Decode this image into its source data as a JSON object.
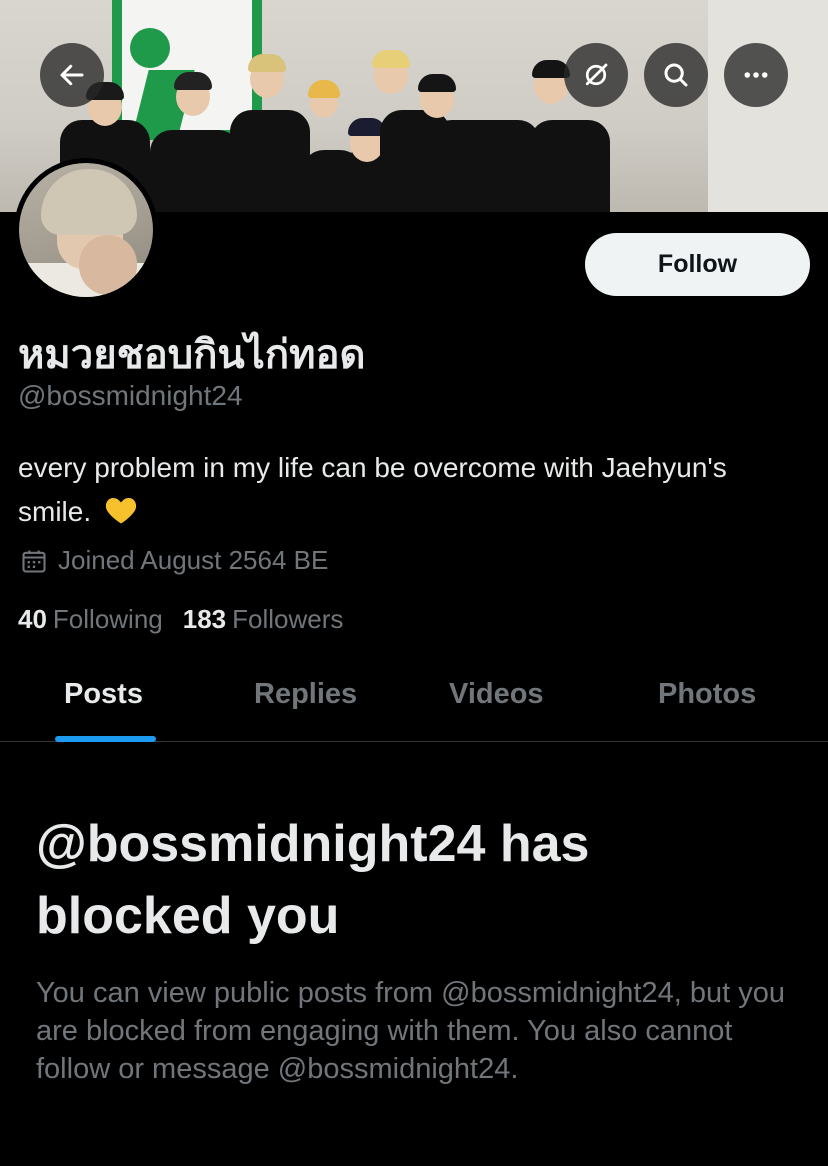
{
  "header": {
    "back_icon": "arrow-left-icon",
    "icons": [
      "grok-icon",
      "search-icon",
      "more-icon"
    ]
  },
  "profile": {
    "display_name": "หมวยชอบกินไก่ทอด",
    "handle": "@bossmidnight24",
    "bio": "every problem in my life can be overcome with Jaehyun's smile.",
    "bio_emoji": "yellow-heart-icon",
    "joined": "Joined August 2564 BE",
    "following_count": "40",
    "following_label": "Following",
    "followers_count": "183",
    "followers_label": "Followers",
    "follow_label": "Follow"
  },
  "tabs": [
    {
      "label": "Posts",
      "active": true
    },
    {
      "label": "Replies",
      "active": false
    },
    {
      "label": "Videos",
      "active": false
    },
    {
      "label": "Photos",
      "active": false
    }
  ],
  "blocked": {
    "title": "@bossmidnight24 has blocked you",
    "message": "You can view public posts from @bossmidnight24, but you are blocked from engaging with them. You also cannot follow or message @bossmidnight24."
  },
  "colors": {
    "accent": "#1d9bf0",
    "background": "#000000",
    "secondary_text": "#71767b",
    "heart": "#f7c12d"
  }
}
